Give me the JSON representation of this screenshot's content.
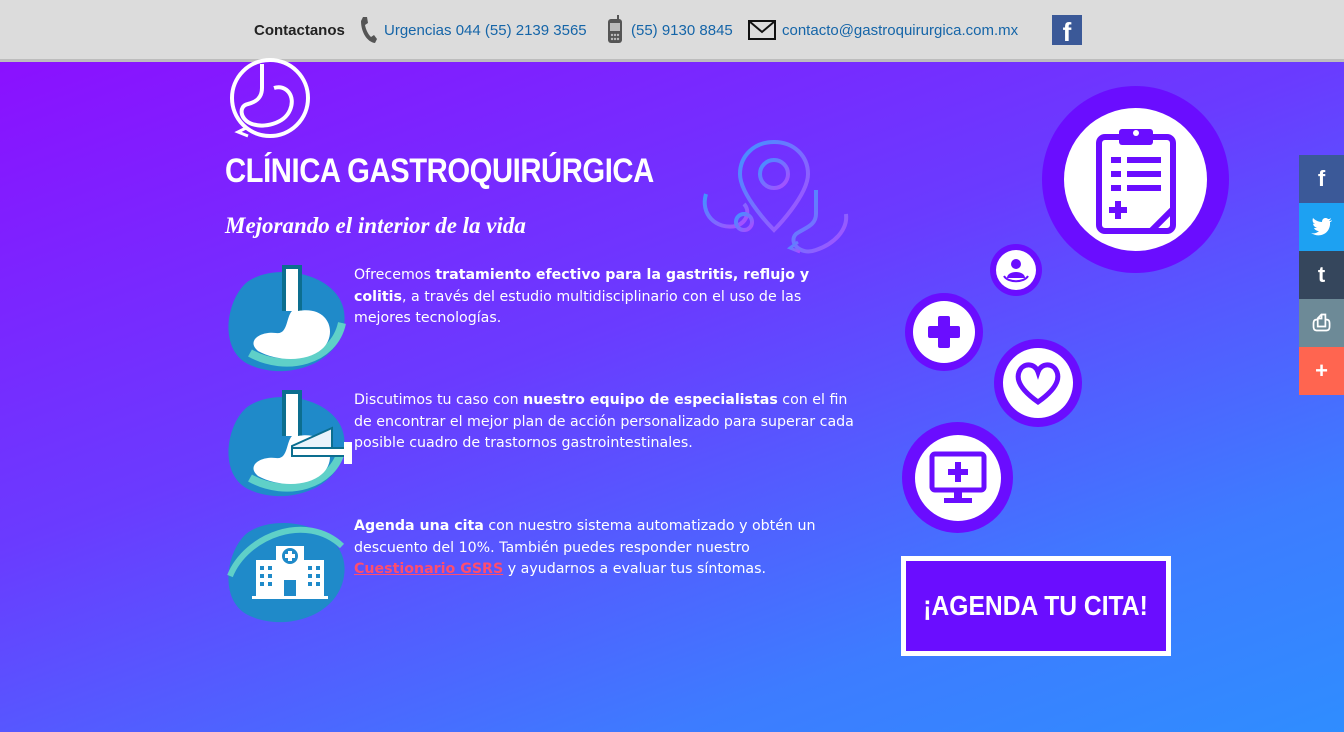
{
  "topbar": {
    "contact_label": "Contactanos",
    "phone_emergency": "Urgencias 044 (55) 2139 3565",
    "phone_mobile": "(55) 9130 8845",
    "email": "contacto@gastroquirurgica.com.mx",
    "facebook_glyph": "f"
  },
  "header": {
    "title": "CLÍNICA GASTROQUIRÚRGICA",
    "tagline": "Mejorando el interior de la vida"
  },
  "features": [
    {
      "icon": "stomach-icon",
      "text_before": "Ofrecemos ",
      "bold": "tratamiento efectivo para la gastritis, reflujo y colitis",
      "text_after": ", a través del estudio multidisciplinario con el uso de las mejores tecnologías."
    },
    {
      "icon": "endoscopy-icon",
      "text_before": "Discutimos tu caso con ",
      "bold": "nuestro equipo de especialistas",
      "text_after": " con el fin de encontrar el mejor plan de acción personalizado para superar cada posible cuadro de trastornos gastrointestinales."
    },
    {
      "icon": "hospital-icon",
      "bold": "Agenda una cita",
      "text_middle": " con nuestro sistema automatizado y obtén un descuento del 10%. También puedes responder nuestro ",
      "link": "Cuestionario GSRS",
      "text_after": " y ayudarnos a evaluar tus síntomas."
    }
  ],
  "cta": {
    "label": "¡AGENDA TU CITA!"
  },
  "share": {
    "facebook": "f",
    "twitter": "t",
    "tumblr": "t",
    "print": "⎙",
    "more": "+"
  },
  "colors": {
    "accent_purple": "#6a0dff",
    "link_red": "#ff4d6d",
    "topbar_bg": "#dcdcdc",
    "facebook": "#3b5998",
    "twitter": "#1da1f2",
    "tumblr": "#35465c",
    "print": "#6d8a97",
    "more": "#ff6550"
  },
  "icons": [
    "phone-icon",
    "mobile-phone-icon",
    "mail-icon",
    "facebook-icon",
    "clinic-logo-icon",
    "location-pin-stethoscope-icon",
    "clipboard-icon",
    "doctor-icon",
    "medical-cross-icon",
    "heart-icon",
    "monitor-icon",
    "twitter-icon",
    "tumblr-icon",
    "print-icon",
    "plus-icon"
  ]
}
